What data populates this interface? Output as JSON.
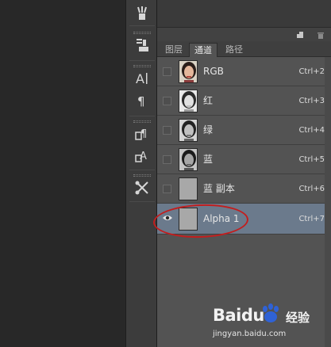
{
  "tabs": [
    {
      "label": "图层",
      "active": false
    },
    {
      "label": "通道",
      "active": true
    },
    {
      "label": "路径",
      "active": false
    }
  ],
  "channels": [
    {
      "name": "RGB",
      "shortcut": "Ctrl+2",
      "visible": false,
      "thumb": "color-portrait",
      "selected": false
    },
    {
      "name": "红",
      "shortcut": "Ctrl+3",
      "visible": false,
      "thumb": "gray-portrait-light",
      "selected": false
    },
    {
      "name": "绿",
      "shortcut": "Ctrl+4",
      "visible": false,
      "thumb": "gray-portrait",
      "selected": false
    },
    {
      "name": "蓝",
      "shortcut": "Ctrl+5",
      "visible": false,
      "thumb": "gray-portrait-dark",
      "selected": false
    },
    {
      "name": "蓝 副本",
      "shortcut": "Ctrl+6",
      "visible": false,
      "thumb": "solid-gray",
      "selected": false
    },
    {
      "name": "Alpha 1",
      "shortcut": "Ctrl+7",
      "visible": true,
      "thumb": "solid-gray",
      "selected": true
    }
  ],
  "toolbar_icons": [
    "brush-presets-icon",
    "clone-source-icon",
    "character-icon",
    "paragraph-icon",
    "character-styles-icon",
    "paragraph-styles-icon",
    "tool-presets-icon"
  ],
  "watermark": {
    "logo": "Baidu",
    "suffix": "经验",
    "url": "jingyan.baidu.com"
  },
  "colors": {
    "selected_row": "#6b7a8c",
    "annotation": "#c21e1e",
    "panel_bg": "#535353"
  }
}
